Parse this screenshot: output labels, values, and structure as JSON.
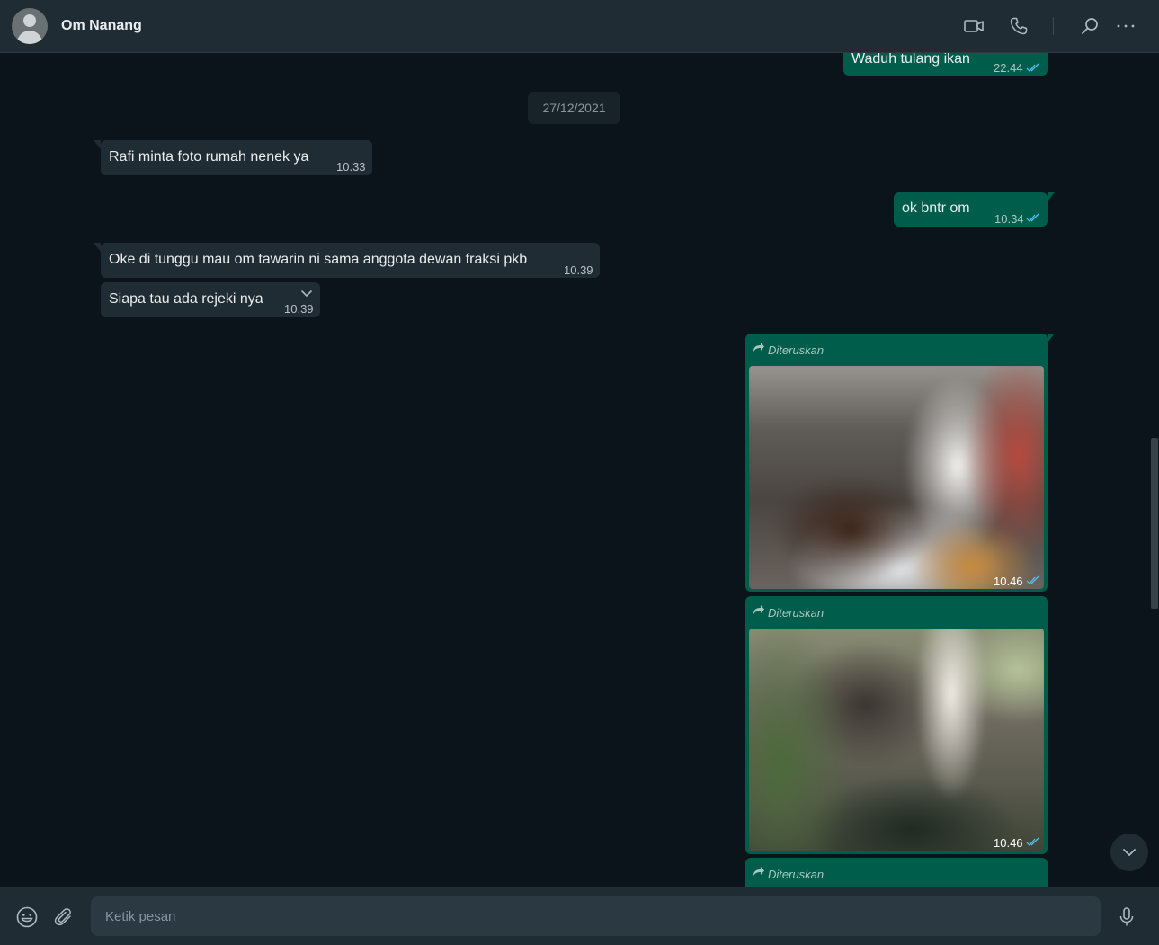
{
  "header": {
    "contact_name": "Om Nanang",
    "icons": [
      "video-call-icon",
      "voice-call-icon",
      "search-icon",
      "menu-icon"
    ]
  },
  "chat": {
    "messages_prev": [
      {
        "direction": "outgoing",
        "text": "Waduh tulang ikan",
        "time": "22.44",
        "status": "read"
      }
    ],
    "date_divider": "27/12/2021",
    "messages": [
      {
        "direction": "incoming",
        "text": "Rafi minta foto rumah nenek ya",
        "time": "10.33"
      },
      {
        "direction": "outgoing",
        "text": "ok bntr om",
        "time": "10.34",
        "status": "read"
      },
      {
        "direction": "incoming",
        "text": "Oke di tunggu mau om tawarin ni sama anggota dewan fraksi pkb",
        "time": "10.39"
      },
      {
        "direction": "incoming",
        "text": "Siapa tau ada rejeki nya",
        "time": "10.39"
      },
      {
        "direction": "outgoing",
        "type": "image",
        "forwarded_label": "Diteruskan",
        "time": "10.46",
        "status": "read"
      },
      {
        "direction": "outgoing",
        "type": "image",
        "forwarded_label": "Diteruskan",
        "time": "10.46",
        "status": "read"
      },
      {
        "direction": "outgoing",
        "type": "image",
        "forwarded_label": "Diteruskan"
      }
    ]
  },
  "composer": {
    "placeholder": "Ketik pesan",
    "icons": [
      "emoji-icon",
      "attach-icon",
      "microphone-icon"
    ]
  },
  "colors": {
    "header_bg": "#202c33",
    "chat_bg": "#0b141a",
    "incoming_bubble": "#202c33",
    "outgoing_bubble": "#005c4b",
    "read_ticks": "#53bdeb"
  }
}
